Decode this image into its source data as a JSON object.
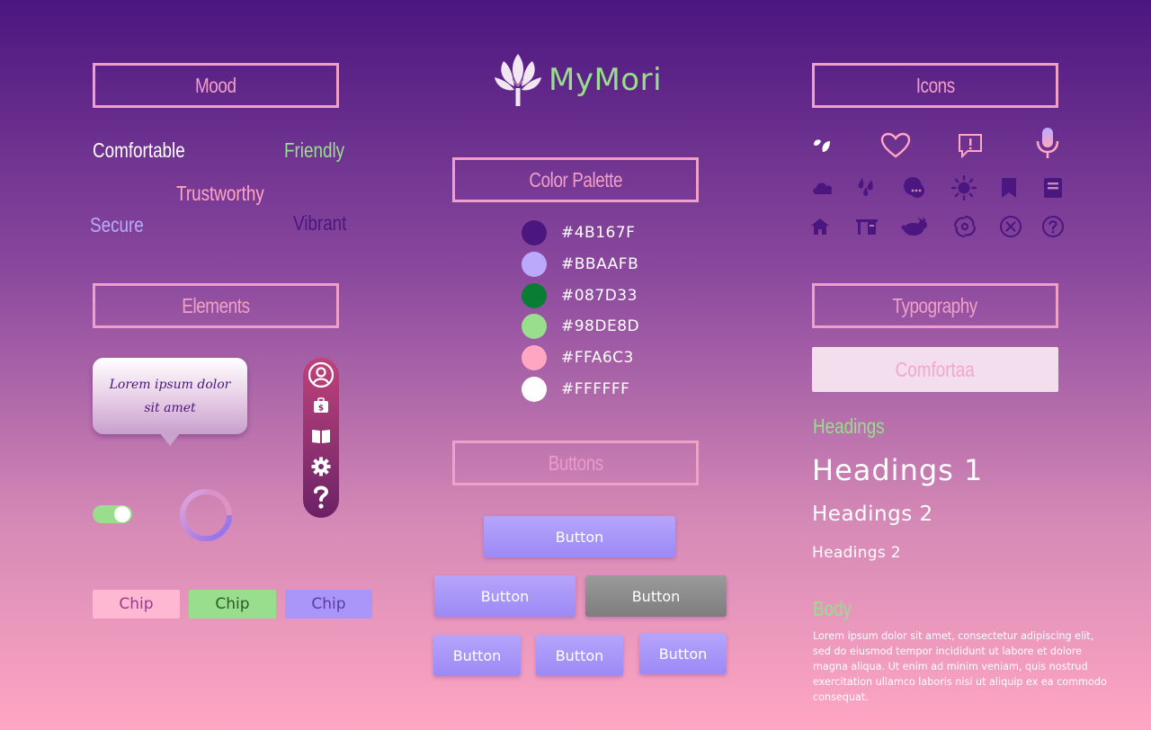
{
  "brand": {
    "name": "MyMori"
  },
  "sections": {
    "mood": "Mood",
    "elements": "Elements",
    "color_palette": "Color Palette",
    "buttons": "Buttons",
    "icons": "Icons",
    "typography": "Typography"
  },
  "mood_words": {
    "comfortable": "Comfortable",
    "friendly": "Friendly",
    "trustworthy": "Trustworthy",
    "secure": "Secure",
    "vibrant": "Vibrant"
  },
  "palette": [
    {
      "hex": "#4B167F",
      "label": "#4B167F"
    },
    {
      "hex": "#BBAAFB",
      "label": "#BBAAFB"
    },
    {
      "hex": "#087D33",
      "label": "#087D33"
    },
    {
      "hex": "#98DE8D",
      "label": "#98DE8D"
    },
    {
      "hex": "#FFA6C3",
      "label": "#FFA6C3"
    },
    {
      "hex": "#FFFFFF",
      "label": "#FFFFFF"
    }
  ],
  "elements": {
    "bubble_text": "Lorem ipsum dolor sit amet",
    "toggle_on": true,
    "nav_icons": [
      "user-circle-icon",
      "briefcase-dollar-icon",
      "book-open-icon",
      "gear-icon",
      "question-icon"
    ],
    "chips": [
      "Chip",
      "Chip",
      "Chip"
    ]
  },
  "buttons": {
    "primary": "Button",
    "row2_left": "Button",
    "row2_disabled": "Button",
    "row3_a": "Button",
    "row3_b": "Button",
    "row3_c": "Button"
  },
  "icons": [
    "leaves-icon",
    "heart-icon",
    "chat-alert-icon",
    "microphone-icon",
    "cloud-icon",
    "droplets-icon",
    "chat-bubbles-icon",
    "sun-icon",
    "bookmark-icon",
    "notebook-icon",
    "home-icon",
    "desk-icon",
    "rabbit-icon",
    "spiral-icon",
    "close-circle-icon",
    "help-circle-icon"
  ],
  "typography": {
    "font_name": "Comfortaa",
    "headings_label": "Headings",
    "heading1": "Headings 1",
    "heading2": "Headings 2",
    "heading3": "Headings 2",
    "body_label": "Body",
    "body_text": "Lorem ipsum dolor sit amet, consectetur adipiscing elit, sed do eiusmod tempor incididunt ut labore et dolore magna aliqua. Ut enim ad minim veniam, quis nostrud exercitation ullamco laboris nisi ut aliquip ex ea commodo consequat."
  },
  "colors": {
    "primary_purple": "#4B167F",
    "lavender": "#BBAAFB",
    "dark_green": "#087D33",
    "light_green": "#98DE8D",
    "pink": "#FFA6C3",
    "white": "#FFFFFF"
  }
}
